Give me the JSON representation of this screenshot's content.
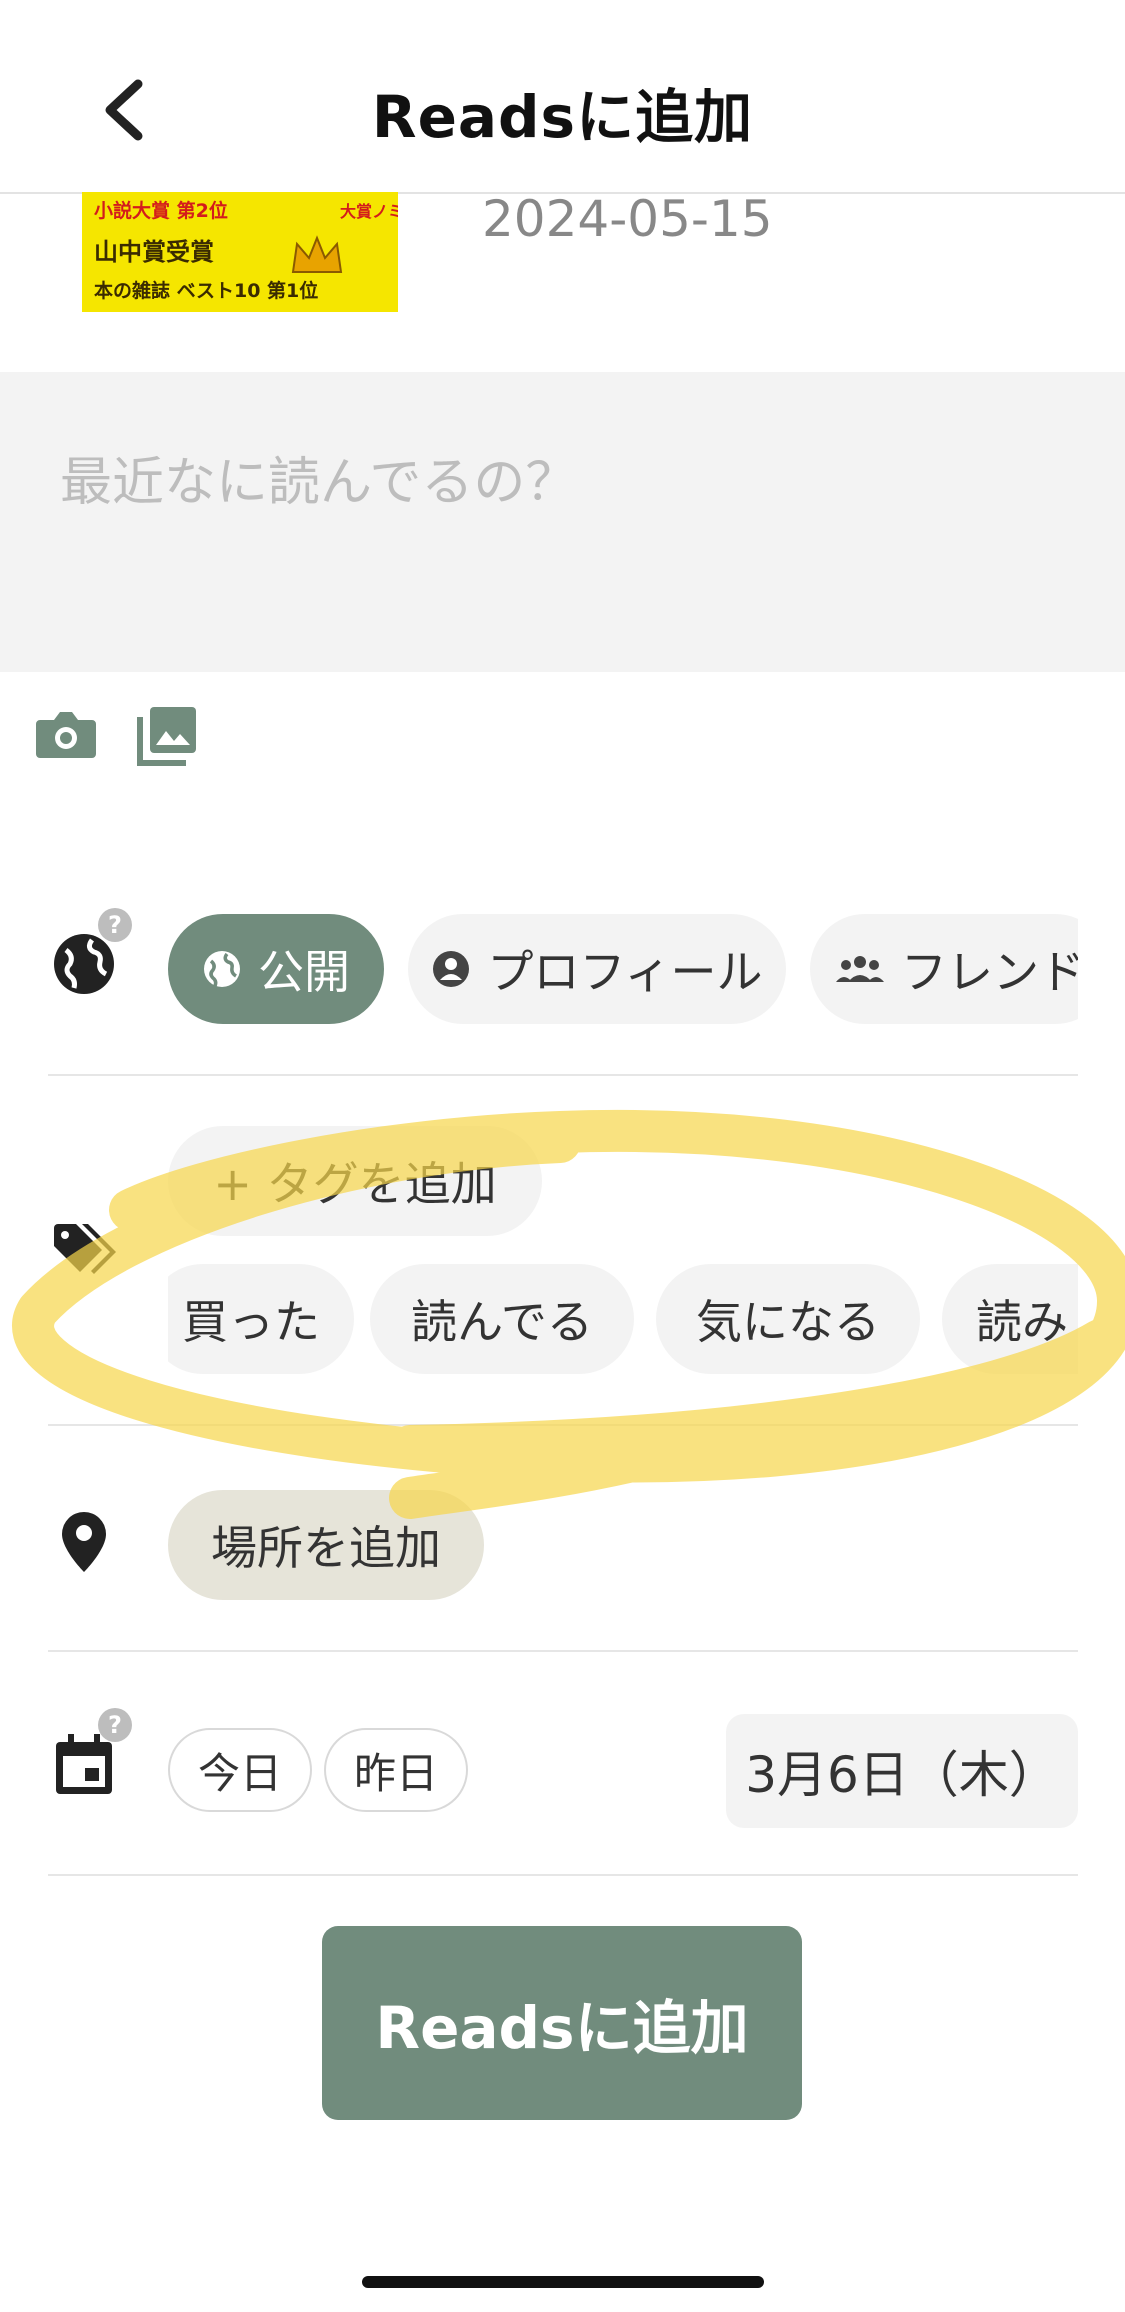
{
  "header": {
    "title": "Readsに追加",
    "back_icon": "chevron-left-icon"
  },
  "book": {
    "cover_lines": [
      {
        "text": "小説大賞 第2位",
        "red": true
      },
      {
        "text": "山中賞受賞",
        "red": false
      },
      {
        "text": "本の雑誌 ベスト10 第1位",
        "red": false
      }
    ],
    "cover_side_text": "大賞ノミネート",
    "published_date": "2024-05-15"
  },
  "note": {
    "placeholder": "最近なに読んでるの？"
  },
  "media": {
    "camera_icon": "camera-icon",
    "gallery_icon": "gallery-icon"
  },
  "visibility": {
    "help_label": "?",
    "options": [
      {
        "label": "公開",
        "icon": "globe-icon",
        "active": true
      },
      {
        "label": "プロフィール",
        "icon": "account-circle-icon",
        "active": false
      },
      {
        "label": "フレンド",
        "icon": "group-icon",
        "active": false
      }
    ]
  },
  "tags": {
    "add_label": "+ タグを追加",
    "suggestions": [
      "買った",
      "読んでる",
      "気になる",
      "読み"
    ]
  },
  "location": {
    "add_label": "場所を追加"
  },
  "date": {
    "help_label": "?",
    "today_label": "今日",
    "yesterday_label": "昨日",
    "selected": "3月6日（木）"
  },
  "submit_label": "Readsに追加",
  "colors": {
    "accent": "#718c7d",
    "location_chip": "#e6e4d9",
    "highlight": "#f6d64a",
    "cover": "#f5e600"
  }
}
